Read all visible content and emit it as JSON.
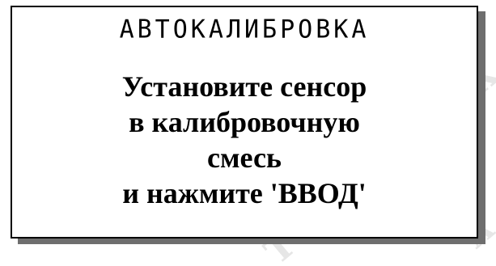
{
  "dialog": {
    "title": "АВТОКАЛИБРОВКА",
    "message_lines": [
      "Установите сенсор",
      "в калибровочную",
      "смесь",
      "и нажмите 'ВВОД'"
    ]
  },
  "colors": {
    "background": "#ffffff",
    "border": "#000000",
    "shadow": "#6e6e6e",
    "text": "#000000",
    "watermark": "#e6e6e6"
  }
}
